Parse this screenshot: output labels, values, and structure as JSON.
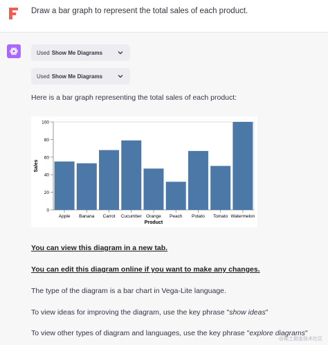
{
  "user": {
    "message": "Draw a bar graph to represent the total sales of each product."
  },
  "assistant": {
    "plugin_calls": [
      {
        "prefix": "Used",
        "name": "Show Me Diagrams"
      },
      {
        "prefix": "Used",
        "name": "Show Me Diagrams"
      }
    ],
    "intro": "Here is a bar graph representing the total sales of each product:",
    "link_view": "You can view this diagram in a new tab.",
    "link_edit": "You can edit this diagram online if you want to make any changes.",
    "type_note": "The type of the diagram is a bar chart in Vega-Lite language.",
    "ideas_prefix": "To view ideas for improving the diagram, use the key phrase \"",
    "ideas_phrase": "show ideas",
    "ideas_suffix": "\"",
    "explore_prefix": "To view other types of diagram and languages, use the key phrase \"",
    "explore_phrase": "explore diagrams",
    "explore_suffix": "\""
  },
  "watermark": "@稀土掘金技术社区",
  "colors": {
    "bar": "#4c78a8",
    "assistant_avatar": "#ab68ff",
    "user_avatar": "#f25c54"
  },
  "chart_data": {
    "type": "bar",
    "categories": [
      "Apple",
      "Banana",
      "Carrot",
      "Cucumber",
      "Orange",
      "Peach",
      "Potato",
      "Tomato",
      "Watermelon"
    ],
    "values": [
      55,
      53,
      68,
      79,
      47,
      32,
      67,
      50,
      100
    ],
    "xlabel": "Product",
    "ylabel": "Sales",
    "ylim": [
      0,
      100
    ],
    "yticks": [
      0,
      20,
      40,
      60,
      80,
      100
    ],
    "grid": false
  }
}
